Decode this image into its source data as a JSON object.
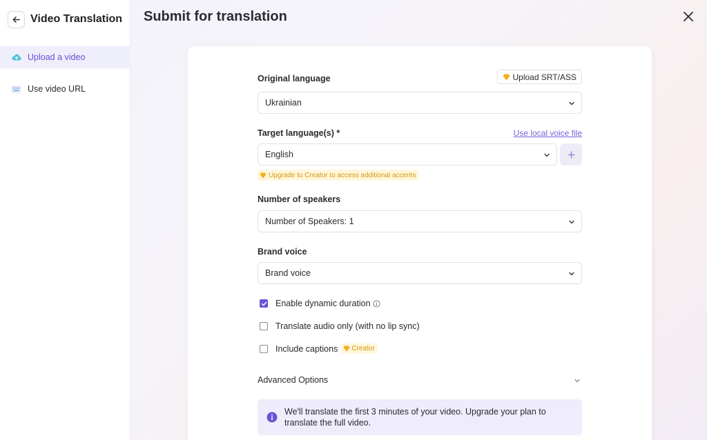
{
  "sidebar": {
    "title": "Video Translation",
    "items": [
      {
        "label": "Upload a video",
        "active": true,
        "icon": "cloud-upload-icon"
      },
      {
        "label": "Use video URL",
        "active": false,
        "icon": "keyboard-icon"
      }
    ]
  },
  "page": {
    "title": "Submit for translation"
  },
  "form": {
    "original_language": {
      "label": "Original language",
      "value": "Ukrainian",
      "upload_srt_label": "Upload SRT/ASS"
    },
    "target_language": {
      "label": "Target language(s) *",
      "value": "English",
      "local_voice_link": "Use local voice file",
      "add_label": "+",
      "upgrade_note": "Upgrade to Creator to access additional accents"
    },
    "speakers": {
      "label": "Number of speakers",
      "value": "Number of Speakers: 1"
    },
    "brand_voice": {
      "label": "Brand voice",
      "value": "Brand voice"
    },
    "options": [
      {
        "label": "Enable dynamic duration",
        "checked": true,
        "info_icon": true
      },
      {
        "label": "Translate audio only (with no lip sync)",
        "checked": false
      },
      {
        "label": "Include captions",
        "checked": false,
        "badge": "Creator"
      }
    ],
    "advanced_label": "Advanced Options",
    "notice": "We'll translate the first 3 minutes of your video. Upgrade your plan to translate the full video."
  },
  "colors": {
    "accent": "#6b52d8",
    "premium": "#f2b01e",
    "notice_bg": "#efedfb"
  }
}
